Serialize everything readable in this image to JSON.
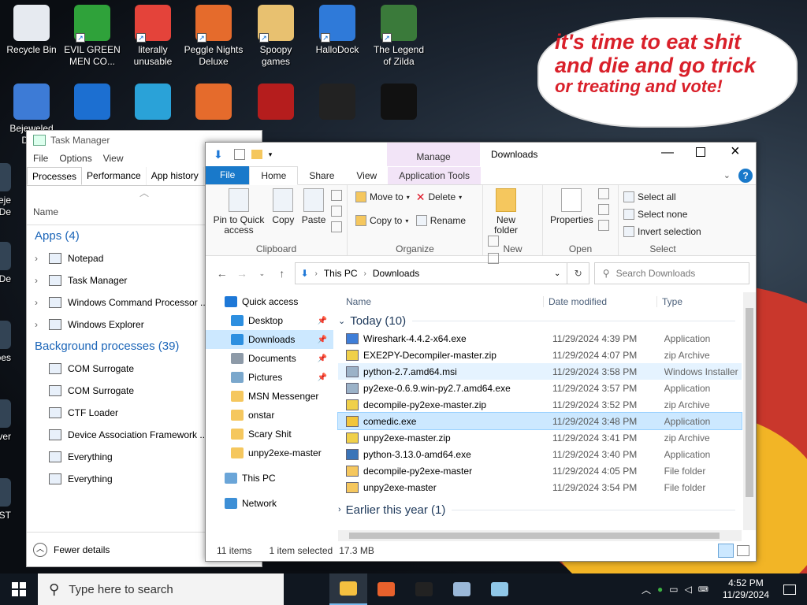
{
  "desktop": {
    "icons": [
      {
        "label": "Recycle Bin",
        "icon": "recycle-bin-icon",
        "color": "#e6eaf0"
      },
      {
        "label": "EVIL GREEN MEN CO...",
        "icon": "msn-people-icon",
        "color": "#2fa23a"
      },
      {
        "label": "literally unusable",
        "icon": "chrome-icon",
        "color": "#e4433a"
      },
      {
        "label": "Peggle Nights Deluxe",
        "icon": "peggle-icon",
        "color": "#e56b2c"
      },
      {
        "label": "Spoopy games",
        "icon": "folder-icon",
        "color": "#e8c170"
      },
      {
        "label": "HalloDock",
        "icon": "windows-shield-icon",
        "color": "#2f7ad9"
      },
      {
        "label": "The Legend of Zilda",
        "icon": "zelda-icon",
        "color": "#3a7a3a"
      }
    ],
    "row2": [
      {
        "label": "Bejeweled De...",
        "icon": "bejeweled-icon",
        "color": "#3d7bd6"
      },
      {
        "label": "",
        "icon": "mpl-icon",
        "color": "#1c6fd1"
      },
      {
        "label": "",
        "icon": "edge-icon",
        "color": "#2aa2d8"
      },
      {
        "label": "",
        "icon": "peggle-icon",
        "color": "#e56b2c"
      },
      {
        "label": "",
        "icon": "flash-icon",
        "color": "#b51d1d"
      },
      {
        "label": "",
        "icon": "rdp-icon",
        "color": "#222"
      },
      {
        "label": "",
        "icon": "yashma-icon",
        "color": "#111"
      }
    ],
    "left_labels": [
      "Beje De",
      "Ch De",
      "does",
      "Ever",
      "!INST"
    ],
    "speech_bubble": [
      "it's time to eat shit",
      "and die and go trick",
      "or treating and vote!"
    ]
  },
  "task_manager": {
    "title": "Task Manager",
    "menu": [
      "File",
      "Options",
      "View"
    ],
    "tabs": [
      "Processes",
      "Performance",
      "App history",
      "S"
    ],
    "column_name": "Name",
    "apps_header": "Apps (4)",
    "apps": [
      "Notepad",
      "Task Manager",
      "Windows Command Processor ...",
      "Windows Explorer"
    ],
    "bg_header": "Background processes (39)",
    "bg": [
      "COM Surrogate",
      "COM Surrogate",
      "CTF Loader",
      "Device Association Framework ...",
      "Everything",
      "Everything"
    ],
    "fewer_details": "Fewer details"
  },
  "explorer": {
    "title": "Downloads",
    "manage_tab": "Manage",
    "tabs": {
      "file": "File",
      "home": "Home",
      "share": "Share",
      "view": "View",
      "app_tools": "Application Tools"
    },
    "clipboard": {
      "pin": "Pin to Quick access",
      "copy": "Copy",
      "paste": "Paste",
      "label": "Clipboard"
    },
    "organize": {
      "move_to": "Move to",
      "copy_to": "Copy to",
      "delete": "Delete",
      "rename": "Rename",
      "label": "Organize"
    },
    "new": {
      "new_folder": "New folder",
      "label": "New"
    },
    "open": {
      "properties": "Properties",
      "label": "Open"
    },
    "select": {
      "select_all": "Select all",
      "select_none": "Select none",
      "invert": "Invert selection",
      "label": "Select"
    },
    "address": {
      "this_pc": "This PC",
      "downloads": "Downloads"
    },
    "search_placeholder": "Search Downloads",
    "nav": [
      {
        "label": "Quick access",
        "color": "#1e78d7",
        "pin": false
      },
      {
        "label": "Desktop",
        "color": "#2d8fe0",
        "pin": true
      },
      {
        "label": "Downloads",
        "color": "#2d8fe0",
        "pin": true
      },
      {
        "label": "Documents",
        "color": "#8d9aa8",
        "pin": true
      },
      {
        "label": "Pictures",
        "color": "#7aa7cc",
        "pin": true
      },
      {
        "label": "MSN Messenger",
        "color": "#f5c75e",
        "pin": false
      },
      {
        "label": "onstar",
        "color": "#f5c75e",
        "pin": false
      },
      {
        "label": "Scary Shit",
        "color": "#f5c75e",
        "pin": false
      },
      {
        "label": "unpy2exe-master",
        "color": "#f5c75e",
        "pin": false
      }
    ],
    "nav_thispc": "This PC",
    "nav_network": "Network",
    "columns": {
      "name": "Name",
      "date": "Date modified",
      "type": "Type"
    },
    "group_today": "Today (10)",
    "group_earlier": "Earlier this year (1)",
    "files": [
      {
        "name": "Wireshark-4.4.2-x64.exe",
        "date": "11/29/2024 4:39 PM",
        "type": "Application",
        "color": "#3f7ed8"
      },
      {
        "name": "EXE2PY-Decompiler-master.zip",
        "date": "11/29/2024 4:07 PM",
        "type": "zip Archive",
        "color": "#f0d04a"
      },
      {
        "name": "python-2.7.amd64.msi",
        "date": "11/29/2024 3:58 PM",
        "type": "Windows Installer ...",
        "color": "#9bb2c8"
      },
      {
        "name": "py2exe-0.6.9.win-py2.7.amd64.exe",
        "date": "11/29/2024 3:57 PM",
        "type": "Application",
        "color": "#9bb2c8"
      },
      {
        "name": "decompile-py2exe-master.zip",
        "date": "11/29/2024 3:52 PM",
        "type": "zip Archive",
        "color": "#f0d04a"
      },
      {
        "name": "comedic.exe",
        "date": "11/29/2024 3:48 PM",
        "type": "Application",
        "color": "#f2c53a"
      },
      {
        "name": "unpy2exe-master.zip",
        "date": "11/29/2024 3:41 PM",
        "type": "zip Archive",
        "color": "#f0d04a"
      },
      {
        "name": "python-3.13.0-amd64.exe",
        "date": "11/29/2024 3:40 PM",
        "type": "Application",
        "color": "#3b74b8"
      },
      {
        "name": "decompile-py2exe-master",
        "date": "11/29/2024 4:05 PM",
        "type": "File folder",
        "color": "#f5c75e"
      },
      {
        "name": "unpy2exe-master",
        "date": "11/29/2024 3:54 PM",
        "type": "File folder",
        "color": "#f5c75e"
      }
    ],
    "status": {
      "count": "11 items",
      "selected": "1 item selected",
      "size": "17.3 MB"
    }
  },
  "taskbar": {
    "search": "Type here to search",
    "apps": [
      {
        "icon": "file-explorer-icon",
        "color": "#f5c040",
        "active": true
      },
      {
        "icon": "firefox-icon",
        "color": "#e8612c",
        "active": false
      },
      {
        "icon": "cmd-icon",
        "color": "#222",
        "active": false
      },
      {
        "icon": "network-tool-icon",
        "color": "#9ab8d8",
        "active": false
      },
      {
        "icon": "notepad-icon",
        "color": "#8fc7e8",
        "active": false
      }
    ],
    "time": "4:52 PM",
    "date": "11/29/2024"
  }
}
